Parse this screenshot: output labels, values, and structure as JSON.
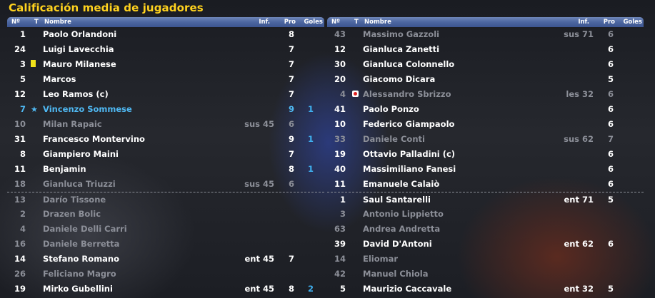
{
  "title": "Calificación media de jugadores",
  "headers": {
    "num": "Nº",
    "t": "T",
    "name": "Nombre",
    "inf": "Inf.",
    "pro": "Pro",
    "goles": "Goles"
  },
  "left_rows": [
    {
      "num": "1",
      "name": "Paolo Orlandoni",
      "inf": "",
      "pro": "8",
      "goles": "",
      "style": "",
      "icon": ""
    },
    {
      "num": "24",
      "name": "Luigi Lavecchia",
      "inf": "",
      "pro": "7",
      "goles": "",
      "style": "",
      "icon": ""
    },
    {
      "num": "3",
      "name": "Mauro Milanese",
      "inf": "",
      "pro": "7",
      "goles": "",
      "style": "",
      "icon": "yellow-card"
    },
    {
      "num": "5",
      "name": "Marcos",
      "inf": "",
      "pro": "7",
      "goles": "",
      "style": "",
      "icon": ""
    },
    {
      "num": "12",
      "name": "Leo Ramos (c)",
      "inf": "",
      "pro": "7",
      "goles": "",
      "style": "",
      "icon": ""
    },
    {
      "num": "7",
      "name": "Vincenzo Sommese",
      "inf": "",
      "pro": "9",
      "goles": "1",
      "style": "hl",
      "icon": "star"
    },
    {
      "num": "10",
      "name": "Milan Rapaic",
      "inf": "sus 45",
      "pro": "6",
      "goles": "",
      "style": "dim",
      "icon": ""
    },
    {
      "num": "31",
      "name": "Francesco Montervino",
      "inf": "",
      "pro": "9",
      "goles": "1",
      "style": "",
      "icon": ""
    },
    {
      "num": "8",
      "name": "Giampiero Maini",
      "inf": "",
      "pro": "7",
      "goles": "",
      "style": "",
      "icon": ""
    },
    {
      "num": "11",
      "name": "Benjamin",
      "inf": "",
      "pro": "8",
      "goles": "1",
      "style": "",
      "icon": ""
    },
    {
      "num": "18",
      "name": "Gianluca Triuzzi",
      "inf": "sus 45",
      "pro": "6",
      "goles": "",
      "style": "dim",
      "icon": ""
    },
    {
      "num": "13",
      "name": "Darío Tissone",
      "inf": "",
      "pro": "",
      "goles": "",
      "style": "dim",
      "icon": "",
      "sep": true
    },
    {
      "num": "2",
      "name": "Drazen Bolic",
      "inf": "",
      "pro": "",
      "goles": "",
      "style": "dim",
      "icon": ""
    },
    {
      "num": "4",
      "name": "Daniele Delli Carri",
      "inf": "",
      "pro": "",
      "goles": "",
      "style": "dim",
      "icon": ""
    },
    {
      "num": "16",
      "name": "Daniele Berretta",
      "inf": "",
      "pro": "",
      "goles": "",
      "style": "dim",
      "icon": ""
    },
    {
      "num": "14",
      "name": "Stefano Romano",
      "inf": "ent 45",
      "pro": "7",
      "goles": "",
      "style": "",
      "icon": ""
    },
    {
      "num": "26",
      "name": "Feliciano Magro",
      "inf": "",
      "pro": "",
      "goles": "",
      "style": "dim",
      "icon": ""
    },
    {
      "num": "19",
      "name": "Mirko Gubellini",
      "inf": "ent 45",
      "pro": "8",
      "goles": "2",
      "style": "",
      "icon": ""
    }
  ],
  "right_rows": [
    {
      "num": "43",
      "name": "Massimo Gazzoli",
      "inf": "sus 71",
      "pro": "6",
      "goles": "",
      "style": "dim",
      "icon": ""
    },
    {
      "num": "12",
      "name": "Gianluca Zanetti",
      "inf": "",
      "pro": "6",
      "goles": "",
      "style": "",
      "icon": ""
    },
    {
      "num": "30",
      "name": "Gianluca Colonnello",
      "inf": "",
      "pro": "6",
      "goles": "",
      "style": "",
      "icon": ""
    },
    {
      "num": "20",
      "name": "Giacomo Dicara",
      "inf": "",
      "pro": "5",
      "goles": "",
      "style": "",
      "icon": ""
    },
    {
      "num": "4",
      "name": "Alessandro Sbrizzo",
      "inf": "les 32",
      "pro": "6",
      "goles": "",
      "style": "dim",
      "icon": "injury"
    },
    {
      "num": "41",
      "name": "Paolo Ponzo",
      "inf": "",
      "pro": "6",
      "goles": "",
      "style": "",
      "icon": ""
    },
    {
      "num": "10",
      "name": "Federico Giampaolo",
      "inf": "",
      "pro": "6",
      "goles": "",
      "style": "",
      "icon": ""
    },
    {
      "num": "33",
      "name": "Daniele Conti",
      "inf": "sus 62",
      "pro": "7",
      "goles": "",
      "style": "dim",
      "icon": ""
    },
    {
      "num": "19",
      "name": "Ottavio Palladini (c)",
      "inf": "",
      "pro": "6",
      "goles": "",
      "style": "",
      "icon": ""
    },
    {
      "num": "40",
      "name": "Massimiliano Fanesi",
      "inf": "",
      "pro": "6",
      "goles": "",
      "style": "",
      "icon": ""
    },
    {
      "num": "11",
      "name": "Emanuele Calaiò",
      "inf": "",
      "pro": "6",
      "goles": "",
      "style": "",
      "icon": ""
    },
    {
      "num": "1",
      "name": "Saul Santarelli",
      "inf": "ent 71",
      "pro": "5",
      "goles": "",
      "style": "",
      "icon": "",
      "sep": true
    },
    {
      "num": "3",
      "name": "Antonio Lippietto",
      "inf": "",
      "pro": "",
      "goles": "",
      "style": "dim",
      "icon": ""
    },
    {
      "num": "63",
      "name": "Andrea Andretta",
      "inf": "",
      "pro": "",
      "goles": "",
      "style": "dim",
      "icon": ""
    },
    {
      "num": "39",
      "name": "David D'Antoni",
      "inf": "ent 62",
      "pro": "6",
      "goles": "",
      "style": "",
      "icon": ""
    },
    {
      "num": "14",
      "name": "Eliomar",
      "inf": "",
      "pro": "",
      "goles": "",
      "style": "dim",
      "icon": ""
    },
    {
      "num": "42",
      "name": "Manuel Chiola",
      "inf": "",
      "pro": "",
      "goles": "",
      "style": "dim",
      "icon": ""
    },
    {
      "num": "5",
      "name": "Maurizio Caccavale",
      "inf": "ent 32",
      "pro": "5",
      "goles": "",
      "style": "",
      "icon": ""
    }
  ]
}
